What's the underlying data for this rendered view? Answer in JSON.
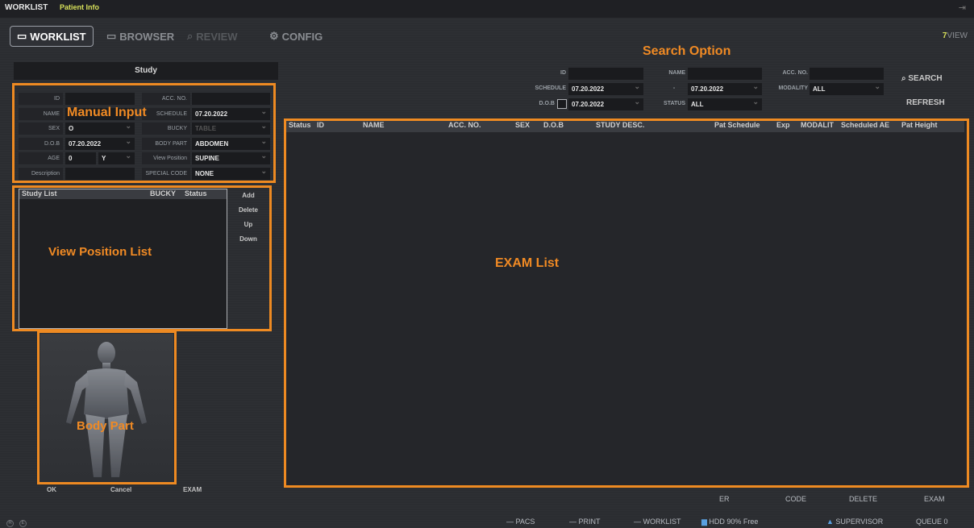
{
  "topbar": {
    "title": "WORKLIST",
    "subtitle": "Patient Info"
  },
  "nav": {
    "worklist": "WORKLIST",
    "browser": "BROWSER",
    "review": "REVIEW",
    "config": "CONFIG",
    "brand_prefix": "7",
    "brand_suffix": "VIEW"
  },
  "study": {
    "header": "Study",
    "fields": {
      "id_label": "ID",
      "id_value": "",
      "acc_label": "ACC. NO.",
      "acc_value": "",
      "name_label": "NAME",
      "name_value": "",
      "schedule_label": "SCHEDULE",
      "schedule_value": "07.20.2022",
      "sex_label": "SEX",
      "sex_value": "O",
      "bucky_label": "BUCKY",
      "bucky_value": "TABLE",
      "dob_label": "D.O.B",
      "dob_value": "07.20.2022",
      "bodypart_label": "BODY PART",
      "bodypart_value": "ABDOMEN",
      "age_label": "AGE",
      "age_value": "0",
      "age_unit": "Y",
      "viewpos_label": "View Position",
      "viewpos_value": "SUPINE",
      "desc_label": "Description",
      "desc_value": "",
      "special_label": "SPECIAL CODE",
      "special_value": "NONE"
    }
  },
  "study_list": {
    "col_study": "Study List",
    "col_bucky": "BUCKY",
    "col_status": "Status",
    "buttons": {
      "add": "Add",
      "delete": "Delete",
      "up": "Up",
      "down": "Down"
    }
  },
  "overlays": {
    "manual_input": "Manual Input",
    "view_position_list": "View Position List",
    "body_part": "Body Part",
    "search_option": "Search Option",
    "exam_list": "EXAM List"
  },
  "left_bottom": {
    "ok": "OK",
    "cancel": "Cancel",
    "exam": "EXAM"
  },
  "search": {
    "id_label": "ID",
    "id_value": "",
    "name_label": "NAME",
    "name_value": "",
    "acc_label": "ACC. NO.",
    "acc_value": "",
    "schedule_label": "SCHEDULE",
    "schedule_from": "07.20.2022",
    "schedule_sep": "-",
    "schedule_to": "07.20.2022",
    "modality_label": "MODALITY",
    "modality_value": "ALL",
    "dob_label": "D.O.B",
    "dob_value": "07.20.2022",
    "status_label": "STATUS",
    "status_value": "ALL",
    "search_btn": "SEARCH",
    "refresh_btn": "REFRESH"
  },
  "exam_columns": {
    "status": "Status",
    "id": "ID",
    "name": "NAME",
    "acc": "ACC. NO.",
    "sex": "SEX",
    "dob": "D.O.B",
    "desc": "STUDY DESC.",
    "schedule": "Pat Schedule",
    "exp": "Exp",
    "modality": "MODALIT",
    "ae": "Scheduled AE",
    "height": "Pat Height"
  },
  "exam_footer": {
    "er": "ER",
    "code": "CODE",
    "delete": "DELETE",
    "exam": "EXAM"
  },
  "statusbar": {
    "r": "R",
    "e": "E",
    "pacs": "PACS",
    "print": "PRINT",
    "worklist": "WORKLIST",
    "hdd": "HDD 90% Free",
    "user": "SUPERVISOR",
    "queue_label": "QUEUE",
    "queue_value": "0"
  },
  "colors": {
    "accent_orange": "#ee8a22",
    "brand_yellow": "#d7e05a"
  }
}
